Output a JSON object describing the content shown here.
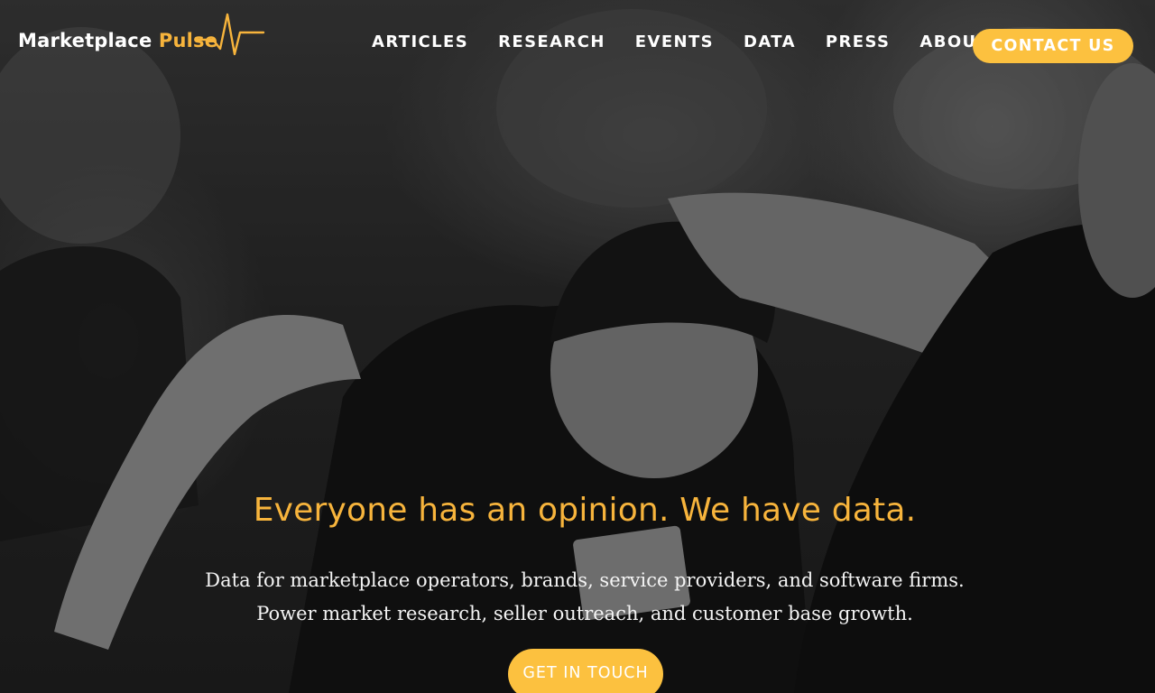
{
  "brand": {
    "name_part1": "Marketplace",
    "name_part2": "Pulse",
    "accent_color": "#f7b43c",
    "logo_icon": "pulse-line-icon"
  },
  "nav": {
    "items": [
      {
        "label": "ARTICLES"
      },
      {
        "label": "RESEARCH"
      },
      {
        "label": "EVENTS"
      },
      {
        "label": "DATA"
      },
      {
        "label": "PRESS"
      },
      {
        "label": "ABOUT"
      }
    ],
    "contact_label": "CONTACT US",
    "button_color": "#fcc13f"
  },
  "hero": {
    "headline": "Everyone has an opinion. We have data.",
    "subtext": "Data for marketplace operators, brands, service providers, and software firms. Power market research, seller outreach, and customer base growth.",
    "cta_label": "GET IN TOUCH"
  }
}
